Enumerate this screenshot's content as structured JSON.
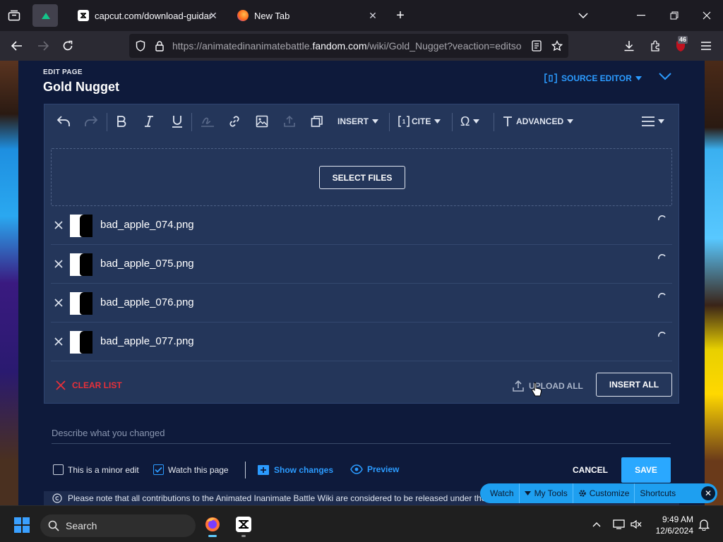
{
  "browser": {
    "tabs": [
      {
        "title": "capcut.com/download-guidan",
        "active": false
      },
      {
        "title": "New Tab",
        "active": false
      }
    ],
    "url": {
      "prefix": "https://animatedinanimatebattle.",
      "host": "fandom.com",
      "suffix": "/wiki/Gold_Nugget?veaction=editso"
    },
    "extension_badge": "46"
  },
  "editor": {
    "edit_page_label": "EDIT PAGE",
    "page_title": "Gold Nugget",
    "source_editor_label": "SOURCE EDITOR",
    "toolbar": {
      "insert_label": "INSERT",
      "cite_label": "CITE",
      "special_char_label": "Ω",
      "advanced_label": "ADVANCED"
    },
    "select_files_label": "SELECT FILES",
    "files": [
      {
        "name": "bad_apple_074.png"
      },
      {
        "name": "bad_apple_075.png"
      },
      {
        "name": "bad_apple_076.png"
      },
      {
        "name": "bad_apple_077.png"
      }
    ],
    "clear_list_label": "CLEAR LIST",
    "upload_all_label": "UPLOAD ALL",
    "insert_all_label": "INSERT ALL",
    "summary_placeholder": "Describe what you changed",
    "minor_edit_label": "This is a minor edit",
    "minor_edit_checked": false,
    "watch_page_label": "Watch this page",
    "watch_page_checked": true,
    "show_changes_label": "Show changes",
    "preview_label": "Preview",
    "cancel_label": "CANCEL",
    "save_label": "SAVE",
    "notice_text": "Please note that all contributions to the Animated Inanimate Battle Wiki are considered to be released under the CC-BY-SA"
  },
  "fandom_bar": {
    "watch": "Watch",
    "my_tools": "My Tools",
    "customize": "Customize",
    "shortcuts": "Shortcuts"
  },
  "taskbar": {
    "search_label": "Search",
    "time": "9:49 AM",
    "date": "12/6/2024"
  },
  "colors": {
    "accent": "#2b9bff",
    "editor_bg": "#0e1a3b",
    "panel_bg": "#24365a",
    "danger": "#e8303a"
  }
}
